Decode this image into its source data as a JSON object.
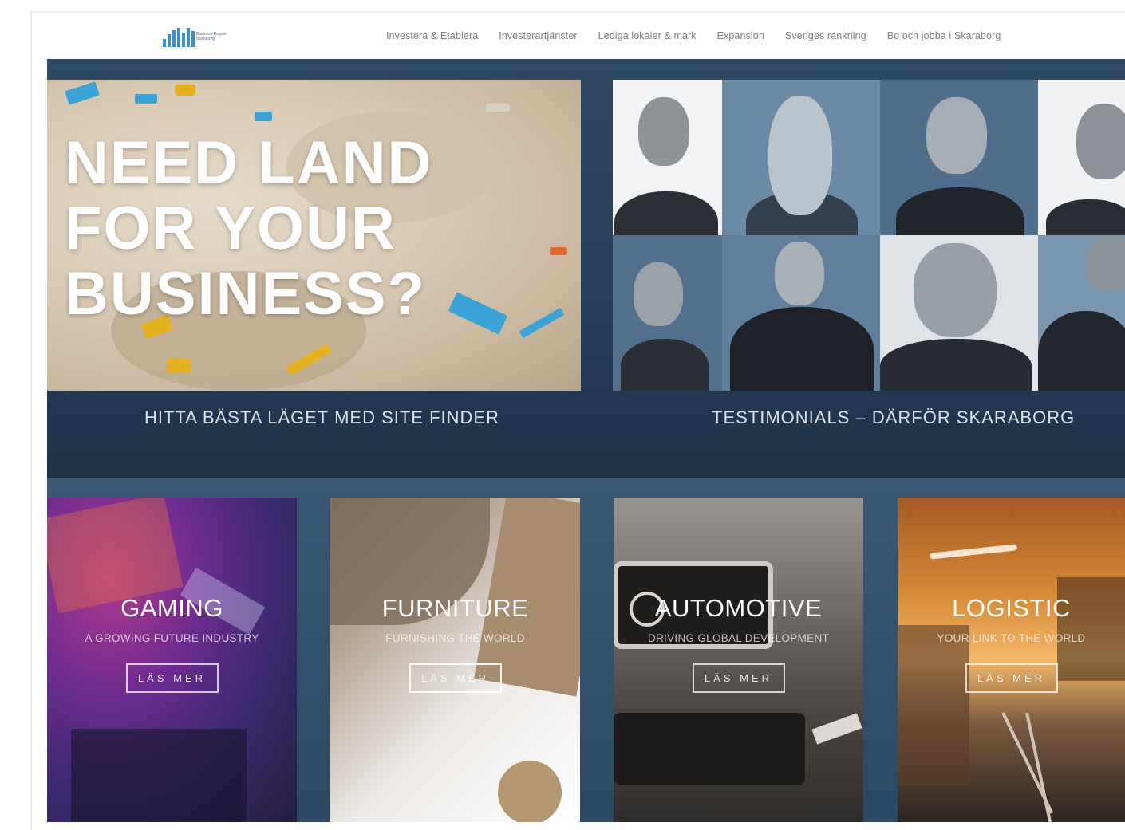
{
  "header": {
    "logo_alt": "Business Region Skaraborg",
    "logo_text": "Business Region Skaraborg",
    "nav": [
      "Investera & Etablera",
      "Investerartjänster",
      "Lediga lokaler & mark",
      "Expansion",
      "Sveriges rankning",
      "Bo och jobba i Skaraborg"
    ]
  },
  "hero": {
    "title_lines": [
      "NEED LAND",
      "FOR YOUR",
      "BUSINESS?"
    ],
    "caption": "HITTA BÄSTA LÄGET MED SITE FINDER"
  },
  "testimonials": {
    "caption": "TESTIMONIALS – DÄRFÖR SKARABORG"
  },
  "cards": [
    {
      "title": "GAMING",
      "subtitle": "A GROWING FUTURE INDUSTRY",
      "button": "LÄS MER"
    },
    {
      "title": "FURNITURE",
      "subtitle": "FURNISHING THE WORLD",
      "button": "LÄS MER"
    },
    {
      "title": "AUTOMOTIVE",
      "subtitle": "DRIVING GLOBAL DEVELOPMENT",
      "button": "LÄS MER"
    },
    {
      "title": "LOGISTIC",
      "subtitle": "YOUR LINK TO THE WORLD",
      "button": "LÄS MER"
    }
  ],
  "colors": {
    "band": "#2e4a63",
    "logo_blue": "#3a8fd2",
    "nav_text": "#7a8088"
  }
}
